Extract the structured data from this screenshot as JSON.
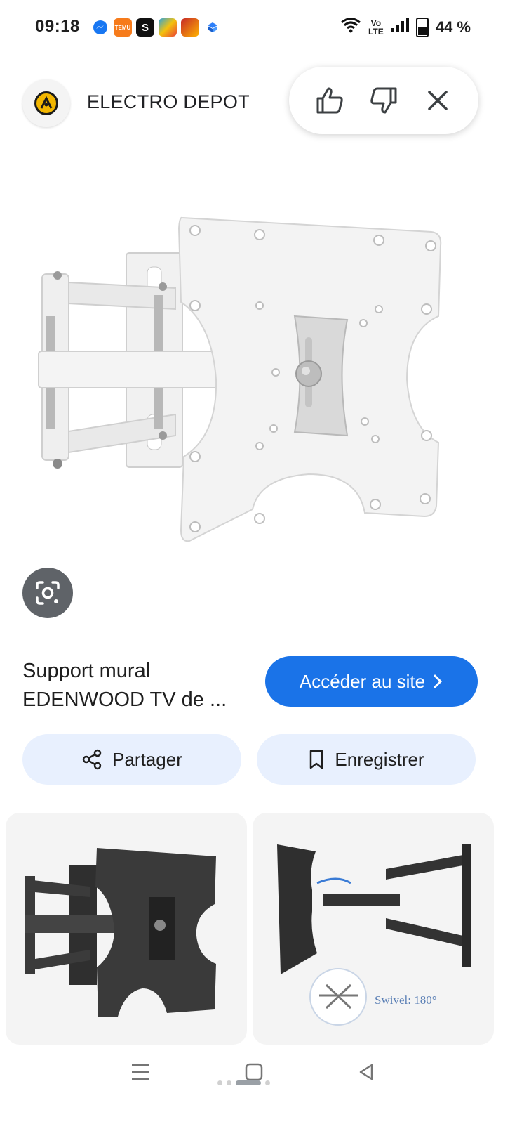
{
  "status_bar": {
    "time": "09:18",
    "battery": "44 %",
    "network": "Vo LTE",
    "notification_apps": [
      "messenger-icon",
      "temu-icon",
      "s-app-icon",
      "game-app-icon",
      "game-app-2-icon",
      "box-app-icon"
    ],
    "temu_label": "TEMU",
    "s_label": "S"
  },
  "header": {
    "site_name": "ELECTRO DEPOT",
    "feedback": {
      "like": "thumbs-up-icon",
      "dislike": "thumbs-down-icon",
      "close": "close-icon"
    }
  },
  "product": {
    "title": "Support mural EDENWOOD TV de ...",
    "visit_label": "Accéder au site",
    "share_label": "Partager",
    "save_label": "Enregistrer"
  },
  "related": {
    "thumb2_caption": "Swivel: 180°"
  },
  "colors": {
    "accent": "#1a73e8",
    "pill": "#e8f0fe",
    "lens": "#5f6368"
  }
}
